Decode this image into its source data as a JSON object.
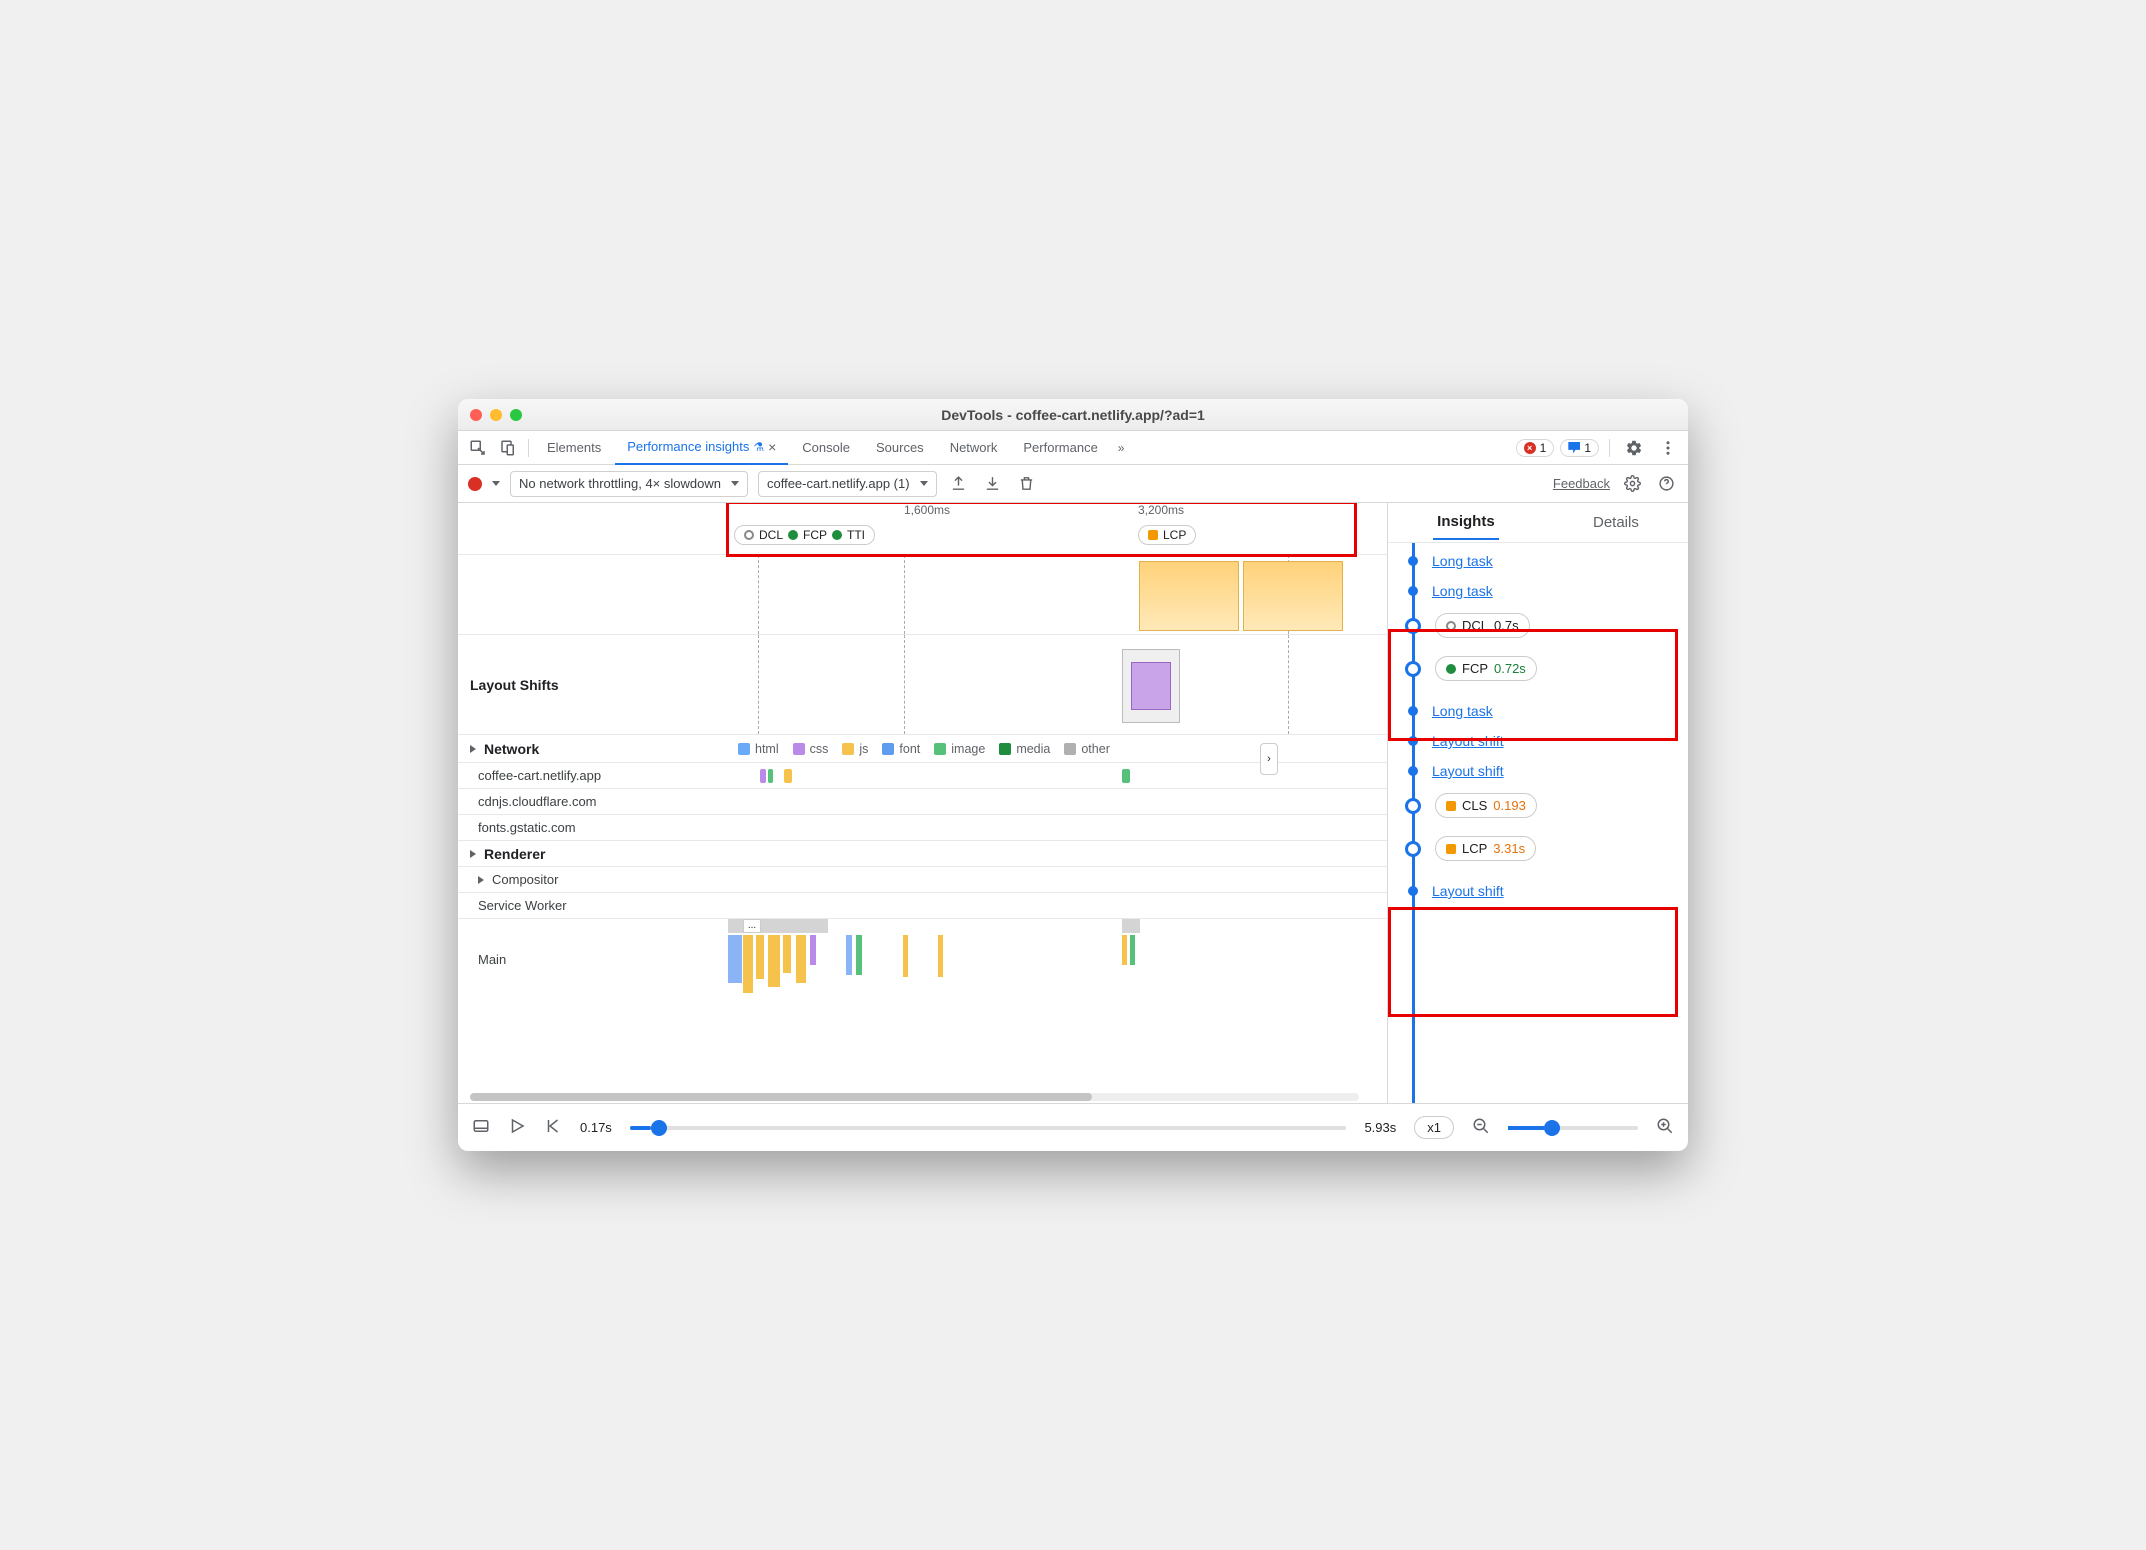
{
  "window_title": "DevTools - coffee-cart.netlify.app/?ad=1",
  "tabs": {
    "elements": "Elements",
    "perf_insights": "Performance insights",
    "console": "Console",
    "sources": "Sources",
    "network": "Network",
    "performance": "Performance"
  },
  "badges": {
    "errors": "1",
    "messages": "1"
  },
  "toolbar": {
    "throttling": "No network throttling, 4× slowdown",
    "page_select": "coffee-cart.netlify.app (1)",
    "feedback": "Feedback"
  },
  "timeline": {
    "t1": "1,600ms",
    "t2": "3,200ms",
    "pill_dcl": "DCL",
    "pill_fcp": "FCP",
    "pill_tti": "TTI",
    "pill_lcp": "LCP"
  },
  "sections": {
    "layout_shifts": "Layout Shifts",
    "network": "Network",
    "renderer": "Renderer",
    "compositor": "Compositor",
    "service_worker": "Service Worker",
    "main": "Main"
  },
  "legend": {
    "html": "html",
    "css": "css",
    "js": "js",
    "font": "font",
    "image": "image",
    "media": "media",
    "other": "other"
  },
  "network_rows": {
    "r0": "coffee-cart.netlify.app",
    "r1": "cdnjs.cloudflare.com",
    "r2": "fonts.gstatic.com"
  },
  "scrubber": {
    "start": "0.17s",
    "end": "5.93s",
    "speed": "x1"
  },
  "right": {
    "insights_tab": "Insights",
    "details_tab": "Details",
    "long_task": "Long task",
    "layout_shift": "Layout shift",
    "dcl_label": "DCL",
    "dcl_val": "0.7s",
    "fcp_label": "FCP",
    "fcp_val": "0.72s",
    "cls_label": "CLS",
    "cls_val": "0.193",
    "lcp_label": "LCP",
    "lcp_val": "3.31s"
  },
  "colors": {
    "html": "#6aa8f8",
    "css": "#b98ae8",
    "js": "#f5c24c",
    "font": "#5f9cf0",
    "image": "#56c17b",
    "media": "#1e8e3e",
    "other": "#b0b0b0",
    "green": "#1e8e3e",
    "orange": "#f29900"
  }
}
